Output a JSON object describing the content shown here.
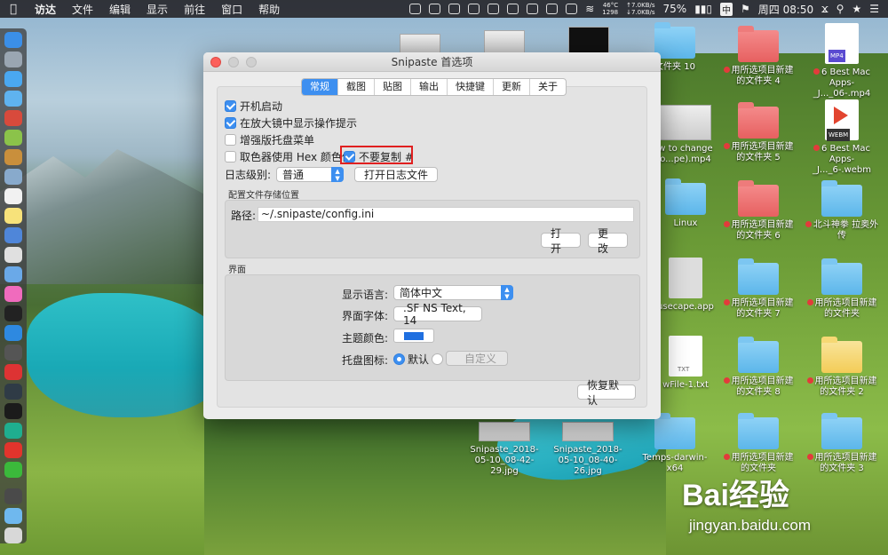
{
  "menubar": {
    "app_name": "访达",
    "menus": [
      "文件",
      "编辑",
      "显示",
      "前往",
      "窗口",
      "帮助"
    ],
    "cpu_temp": "46°C",
    "cpu_rpm": "1298",
    "net_up": "↑7.0KB/s",
    "net_down": "↓7.0KB/s",
    "battery": "75%",
    "ime": "中",
    "clock": "周四 08:50"
  },
  "window": {
    "title": "Snipaste 首选项",
    "tabs": [
      "常规",
      "截图",
      "贴图",
      "输出",
      "快捷键",
      "更新",
      "关于"
    ],
    "active_tab": "常规",
    "general": {
      "autostart": "开机启动",
      "show_hints": "在放大镜中显示操作提示",
      "enhanced_tray": "增强版托盘菜单",
      "hex_color": "取色器使用 Hex 颜色值",
      "no_copy_hash": "不要复制 #",
      "log_level_label": "日志级别:",
      "log_level_value": "普通",
      "open_log_button": "打开日志文件"
    },
    "config": {
      "section_title": "配置文件存储位置",
      "path_label": "路径:",
      "path_value": "~/.snipaste/config.ini",
      "open_button": "打开",
      "change_button": "更改"
    },
    "interface": {
      "section_title": "界面",
      "language_label": "显示语言:",
      "language_value": "简体中文",
      "font_label": "界面字体:",
      "font_value": ".SF NS Text, 14",
      "theme_label": "主题颜色:",
      "tray_label": "托盘图标:",
      "tray_default": "默认",
      "tray_custom": "自定义"
    },
    "reset_button": "恢复默认"
  },
  "desktop": {
    "items": [
      {
        "label": "文件夹 10",
        "type": "folder"
      },
      {
        "label": "用所选项目新建的文件夹 4",
        "type": "folder-red"
      },
      {
        "label": "6 Best Mac Apps-_J..._06-.mp4",
        "type": "mp4"
      },
      {
        "label": "w to change o...pe).mp4",
        "type": "thumb"
      },
      {
        "label": "用所选项目新建的文件夹 5",
        "type": "folder-red"
      },
      {
        "label": "6 Best Mac Apps-_J..._6-.webm",
        "type": "webm"
      },
      {
        "label": "Linux",
        "type": "folder"
      },
      {
        "label": "用所选项目新建的文件夹 6",
        "type": "folder-red"
      },
      {
        "label": "北斗神拳 拉奥外传",
        "type": "folder"
      },
      {
        "label": "usecape.app",
        "type": "app"
      },
      {
        "label": "用所选项目新建的文件夹 7",
        "type": "folder"
      },
      {
        "label": "用所选项目新建的文件夹",
        "type": "folder"
      },
      {
        "label": "wFile-1.txt",
        "type": "txt"
      },
      {
        "label": "用所选项目新建的文件夹 8",
        "type": "folder"
      },
      {
        "label": "用所选项目新建的文件夹 2",
        "type": "folder-yellow"
      },
      {
        "label": "Snipaste_2018-05-10_08-42-29.jpg",
        "type": "thumb"
      },
      {
        "label": "Snipaste_2018-05-10_08-40-26.jpg",
        "type": "thumb"
      },
      {
        "label": "Temps-darwin-x64",
        "type": "folder"
      },
      {
        "label": "用所选项目新建的文件夹",
        "type": "folder"
      },
      {
        "label": "用所选项目新建的文件夹 3",
        "type": "folder"
      }
    ]
  },
  "watermark": {
    "brand": "Bai经验",
    "url": "jingyan.baidu.com"
  }
}
